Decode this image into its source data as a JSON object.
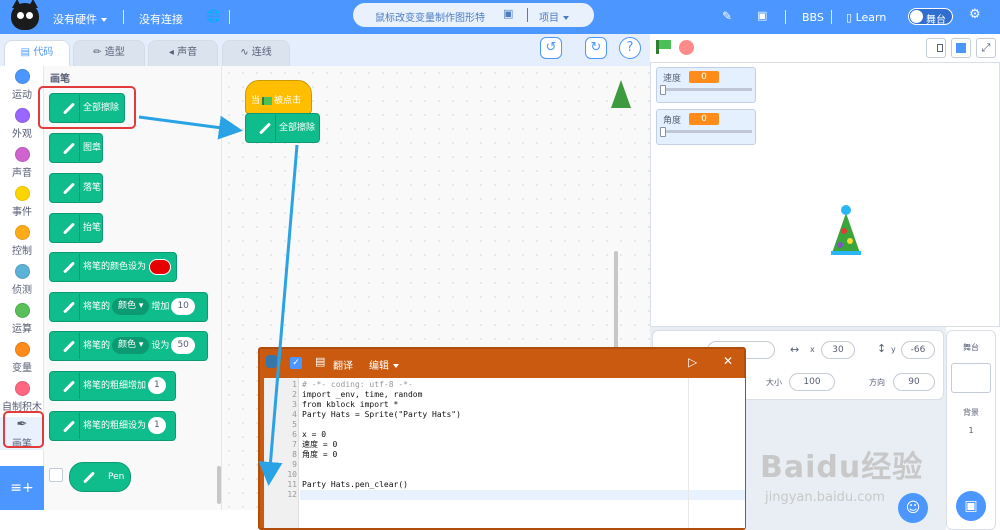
{
  "header": {
    "hardware": "没有硬件",
    "connection": "没有连接",
    "project_title": "鼠标改变变量制作图形特",
    "project_menu": "项目",
    "bbs": "BBS",
    "learn": "Learn",
    "stage_toggle": "舞台"
  },
  "tabs": [
    "代码",
    "造型",
    "声音",
    "连线"
  ],
  "categories": [
    {
      "label": "运动",
      "color": "#4c97ff"
    },
    {
      "label": "外观",
      "color": "#9966ff"
    },
    {
      "label": "声音",
      "color": "#cf63cf"
    },
    {
      "label": "事件",
      "color": "#ffd500"
    },
    {
      "label": "控制",
      "color": "#ffab19"
    },
    {
      "label": "侦测",
      "color": "#5cb1d6"
    },
    {
      "label": "运算",
      "color": "#59c059"
    },
    {
      "label": "变量",
      "color": "#ff8c1a"
    },
    {
      "label": "自制积木",
      "color": "#ff6680"
    },
    {
      "label": "画笔",
      "color": "#0fbd8c"
    }
  ],
  "palette": {
    "section_title": "画笔",
    "blocks": {
      "clear": "全部擦除",
      "stamp": "图章",
      "pen_down": "落笔",
      "pen_up": "抬笔",
      "set_color_to": "将笔的颜色设为",
      "change_prefix": "将笔的",
      "param_color": "颜色",
      "change_by": "增加",
      "change_value": "10",
      "set_prefix": "将笔的",
      "set_to": "设为",
      "set_value": "50",
      "size_change": "将笔的粗细增加",
      "size_change_value": "1",
      "size_set": "将笔的粗细设为",
      "size_set_value": "1"
    },
    "pen_extension": "Pen"
  },
  "script": {
    "hat_label_pre": "当",
    "hat_label_post": "被点击",
    "block_label": "全部擦除"
  },
  "monitors": [
    {
      "label": "速度",
      "value": "0"
    },
    {
      "label": "角度",
      "value": "0"
    }
  ],
  "sprite_info": {
    "x_label": "x",
    "x_value": "30",
    "y_label": "y",
    "y_value": "-66",
    "size_label": "大小",
    "size_value": "100",
    "direction_label": "方向",
    "direction_value": "90"
  },
  "stage_panel": {
    "title": "舞台",
    "backdrop_label": "背景",
    "backdrop_count": "1"
  },
  "code_window": {
    "translate": "翻译",
    "edit": "编辑",
    "lines": [
      {
        "n": "1",
        "text": "# -*- coding: utf-8 -*-"
      },
      {
        "n": "2",
        "text": "import _env, time, random"
      },
      {
        "n": "3",
        "text": "from kblock import *"
      },
      {
        "n": "4",
        "text": "Party Hats = Sprite(\"Party Hats\")"
      },
      {
        "n": "5",
        "text": ""
      },
      {
        "n": "6",
        "text": "x = 0"
      },
      {
        "n": "7",
        "text": "速度 = 0"
      },
      {
        "n": "8",
        "text": "角度 = 0"
      },
      {
        "n": "9",
        "text": ""
      },
      {
        "n": "10",
        "text": ""
      },
      {
        "n": "11",
        "text": "Party Hats.pen_clear()"
      },
      {
        "n": "12",
        "text": ""
      }
    ]
  },
  "watermark": {
    "main": "Baidu经验",
    "sub": "jingyan.baidu.com"
  },
  "colors": {
    "accent": "#4c97ff",
    "pen": "#0fbd8c",
    "events": "#ffbf00",
    "code_window": "#ca5a10",
    "annotation": "#e13b3b"
  }
}
